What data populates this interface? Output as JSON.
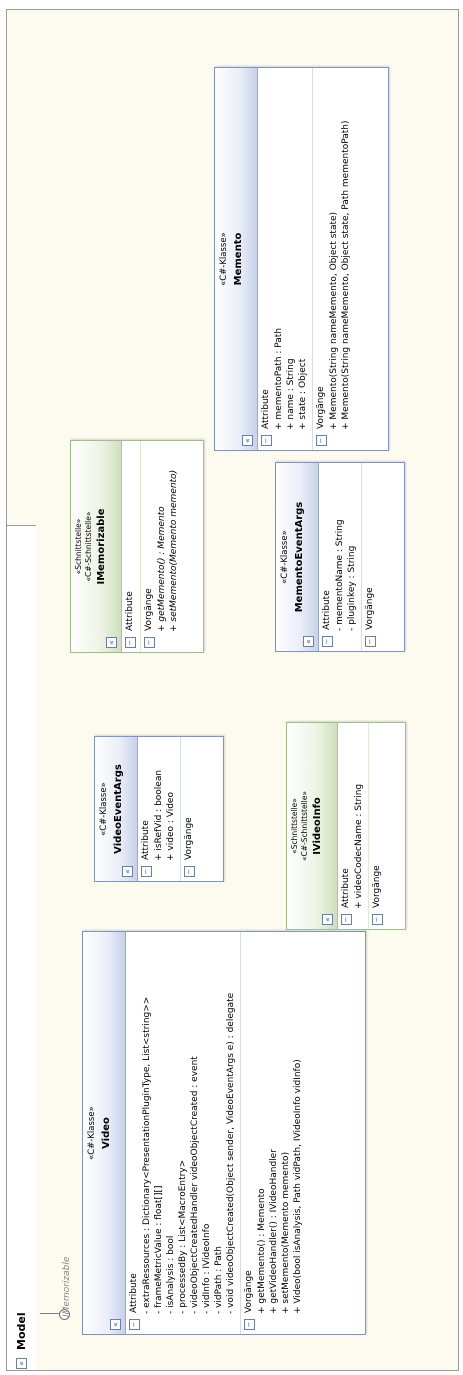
{
  "package": {
    "title": "Model",
    "lollipop_label": "IMemorizable"
  },
  "classes": {
    "video": {
      "stereotype": "«C#-Klasse»",
      "name": "Video",
      "attributes_label": "Attribute",
      "attributes": [
        "- extraRessources : Dictionary<PresentationPluginType, List<string>>",
        "- frameMetricValue : float[][]",
        "- isAnalysis : bool",
        "- processedBy : List<MacroEntry>",
        "- videoObjectCreatedHandler videoObjectCreated : event",
        "- vidInfo : IVideoInfo",
        "- vidPath : Path",
        "- void videoObjectCreated(Object sender, VideoEventArgs e) : delegate"
      ],
      "operations_label": "Vorgänge",
      "operations": [
        "+ getMemento() : Memento",
        "+ getVideoHandler() : IVideoHandler",
        "+ setMemento(Memento memento)",
        "+ Video(bool isAnalysis, Path vidPath, IVideoInfo vidInfo)"
      ]
    },
    "video_event_args": {
      "stereotype": "«C#-Klasse»",
      "name": "VideoEventArgs",
      "attributes_label": "Attribute",
      "attributes": [
        "+ isRefVid : boolean",
        "+ video : Video"
      ],
      "operations_label": "Vorgänge",
      "operations": []
    },
    "imemorizable": {
      "stereotype1": "«Schnittstelle»",
      "stereotype2": "«C#-Schnittstelle»",
      "name": "IMemorizable",
      "attributes_label": "Attribute",
      "attributes": [],
      "operations_label": "Vorgänge",
      "operations": [
        "+ getMemento() : Memento",
        "+ setMemento(Memento memento)"
      ]
    },
    "ivideoinfo": {
      "stereotype1": "«Schnittstelle»",
      "stereotype2": "«C#-Schnittstelle»",
      "name": "IVideoInfo",
      "attributes_label": "Attribute",
      "attributes": [
        "+ videoCodecName : String"
      ],
      "operations_label": "Vorgänge",
      "operations": []
    },
    "memento_event_args": {
      "stereotype": "«C#-Klasse»",
      "name": "MementoEventArgs",
      "attributes_label": "Attribute",
      "attributes": [
        "- mementoName : String",
        "- pluginkey : String"
      ],
      "operations_label": "Vorgänge",
      "operations": []
    },
    "memento": {
      "stereotype": "«C#-Klasse»",
      "name": "Memento",
      "attributes_label": "Attribute",
      "attributes": [
        "+ mementoPath : Path",
        "+ name : String",
        "+ state : Object"
      ],
      "operations_label": "Vorgänge",
      "operations": [
        "+ Memento(String nameMemento, Object state)",
        "+ Memento(String nameMemento, Object state, Path mementoPath)"
      ]
    }
  },
  "icons": {
    "collapse": "«",
    "section_toggle": "−"
  },
  "colors": {
    "class_border": "#7f93c4",
    "interface_border": "#9fbf88",
    "package_background": "#fdfaf0"
  }
}
